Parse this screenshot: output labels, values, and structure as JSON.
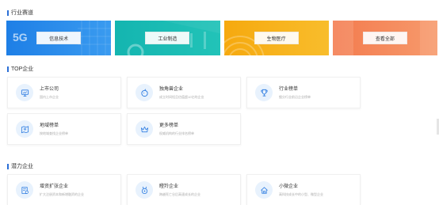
{
  "sections": {
    "industry_title": "行业赛道",
    "top_title": "TOP企业",
    "potential_title": "潜力企业"
  },
  "banners": [
    {
      "label": "信息技术",
      "overlay": "5G",
      "color": "#1e7fe6"
    },
    {
      "label": "工业制造",
      "color": "#14b5b0"
    },
    {
      "label": "生物医疗",
      "color": "#f6a90f"
    },
    {
      "label": "查看全部",
      "color": "#f47b4e"
    }
  ],
  "top_cards": [
    {
      "title": "上市公司",
      "desc": "国内上市企业",
      "icon": "monitor-icon"
    },
    {
      "title": "独角兽企业",
      "desc": "成立时间短且估值超10亿的企业",
      "icon": "unicorn-icon"
    },
    {
      "title": "行业榜单",
      "desc": "细分行业前沿企业榜单",
      "icon": "trophy-icon"
    },
    {
      "title": "地域榜单",
      "desc": "按地域查找企业榜单",
      "icon": "map-icon"
    },
    {
      "title": "更多榜单",
      "desc": "权威机构的行业排名榜单",
      "icon": "crown-icon"
    }
  ],
  "potential_cards": [
    {
      "title": "增资扩张企业",
      "desc": "扩大注册资本和新增融资的企业",
      "icon": "document-chart-icon"
    },
    {
      "title": "瞪羚企业",
      "desc": "跨越死亡谷后高速成长的企业",
      "icon": "gazelle-icon"
    },
    {
      "title": "小微企业",
      "desc": "高科技成长中的小型、微型企业",
      "icon": "house-icon"
    }
  ],
  "accent_color": "#2b6fd6"
}
